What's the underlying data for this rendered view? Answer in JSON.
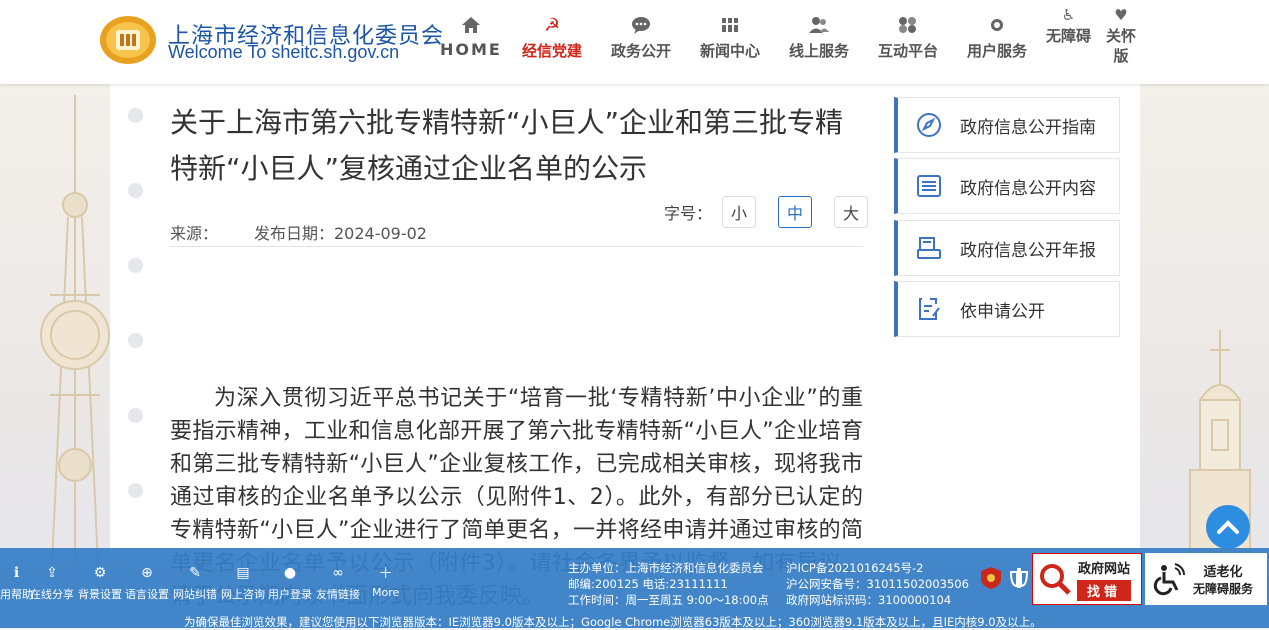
{
  "header": {
    "site_title": "上海市经济和信息化委员会",
    "site_subtitle": "Welcome To sheitc.sh.gov.cn",
    "nav": [
      {
        "label": "HOME",
        "icon": "home-icon"
      },
      {
        "label": "经信党建",
        "icon": "party-emblem-icon",
        "active": true
      },
      {
        "label": "政务公开",
        "icon": "chat-bubble-icon"
      },
      {
        "label": "新闻中心",
        "icon": "newspaper-icon"
      },
      {
        "label": "线上服务",
        "icon": "users-icon"
      },
      {
        "label": "互动平台",
        "icon": "interaction-icon"
      },
      {
        "label": "用户服务",
        "icon": "user-service-icon"
      },
      {
        "label": "无障碍",
        "icon": "wheelchair-icon"
      },
      {
        "label": "关怀版",
        "icon": "care-heart-icon"
      }
    ]
  },
  "article": {
    "title": "关于上海市第六批专精特新“小巨人”企业和第三批专精特新“小巨人”复核通过企业名单的公示",
    "source_label": "来源：",
    "date_label": "发布日期：2024-09-02",
    "font_size_label": "字号：",
    "font_sizes": [
      "小",
      "中",
      "大"
    ],
    "selected_font_size": "中",
    "body": "为深入贯彻习近平总书记关于“培育一批‘专精特新’中小企业”的重要指示精神，工业和信息化部开展了第六批专精特新“小巨人”企业培育和第三批专精特新“小巨人”企业复核工作，已完成相关审核，现将我市通过审核的企业名单予以公示（见附件1、2）。此外，有部分已认定的专精特新“小巨人”企业进行了简单更名，一并将经申请并通过审核的简单更名企业名单予以公示（附件3）。请社会各界予以监督，如有异议，请于公示期内以书面形式向我委反映。"
  },
  "sidebar": [
    {
      "label": "政府信息公开指南",
      "icon": "compass-icon"
    },
    {
      "label": "政府信息公开内容",
      "icon": "list-icon"
    },
    {
      "label": "政府信息公开年报",
      "icon": "report-icon"
    },
    {
      "label": "依申请公开",
      "icon": "apply-form-icon"
    }
  ],
  "toolbar": [
    {
      "label": "用帮助",
      "icon": "info-icon"
    },
    {
      "label": "在线分享",
      "icon": "share-icon"
    },
    {
      "label": "背景设置",
      "icon": "settings-gear-icon"
    },
    {
      "label": "语言设置",
      "icon": "globe-icon"
    },
    {
      "label": "网站纠错",
      "icon": "wrench-icon"
    },
    {
      "label": "网上咨询",
      "icon": "message-icon"
    },
    {
      "label": "用户登录",
      "icon": "user-icon"
    },
    {
      "label": "友情链接",
      "icon": "link-icon"
    },
    {
      "label": "More",
      "icon": "plus-icon"
    }
  ],
  "footer": {
    "sponsor": "主办单位：上海市经济和信息化委员会",
    "icp": "沪ICP备2021016245号-2",
    "postcode_phone": "邮编:200125 电话:23111111",
    "police": "沪公网安备号：31011502003506",
    "hours": "工作时间：周一至周五 9:00～18:00点",
    "site_code": "政府网站标识码：3100000104",
    "find_error_top": "政府网站",
    "find_error_bottom": "找错",
    "elderly_top": "适老化",
    "elderly_bottom": "无障碍服务",
    "browser_note": "为确保最佳浏览效果，建议您使用以下浏览器版本：IE浏览器9.0版本及以上；Google Chrome浏览器63版本及以上；360浏览器9.1版本及以上，且IE内核9.0及以上。"
  },
  "colors": {
    "brand_blue": "#1b55a5",
    "active_red": "#d0261a",
    "accent_blue": "#3d73c5",
    "bottom_bar": "#367ec6"
  }
}
